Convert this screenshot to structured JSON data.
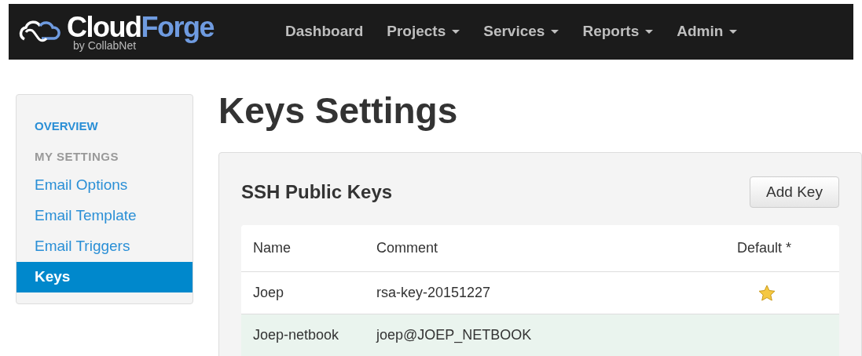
{
  "navbar": {
    "logo": {
      "part_1": "Cloud",
      "part_2": "Forge",
      "tagline": "by CollabNet"
    },
    "items": [
      {
        "label": "Dashboard",
        "dropdown": false
      },
      {
        "label": "Projects",
        "dropdown": true
      },
      {
        "label": "Services",
        "dropdown": true
      },
      {
        "label": "Reports",
        "dropdown": true
      },
      {
        "label": "Admin",
        "dropdown": true
      }
    ]
  },
  "sidebar": {
    "items": [
      {
        "label": "OVERVIEW",
        "kind": "header-link",
        "selected": false
      },
      {
        "label": "MY SETTINGS",
        "kind": "section",
        "selected": false
      },
      {
        "label": "Email Options",
        "kind": "link",
        "selected": false
      },
      {
        "label": "Email Template",
        "kind": "link",
        "selected": false
      },
      {
        "label": "Email Triggers",
        "kind": "link",
        "selected": false
      },
      {
        "label": "Keys",
        "kind": "link",
        "selected": true
      }
    ]
  },
  "page_title": "Keys Settings",
  "panel": {
    "title": "SSH Public Keys",
    "button": "Add Key",
    "table": {
      "columns": [
        "Name",
        "Comment",
        "Default *"
      ],
      "rows": [
        {
          "name": "Joep",
          "comment": "rsa-key-20151227",
          "default": true,
          "selected": false
        },
        {
          "name": "Joep-netbook",
          "comment": "joep@JOEP_NETBOOK",
          "default": false,
          "selected": true
        }
      ]
    }
  }
}
